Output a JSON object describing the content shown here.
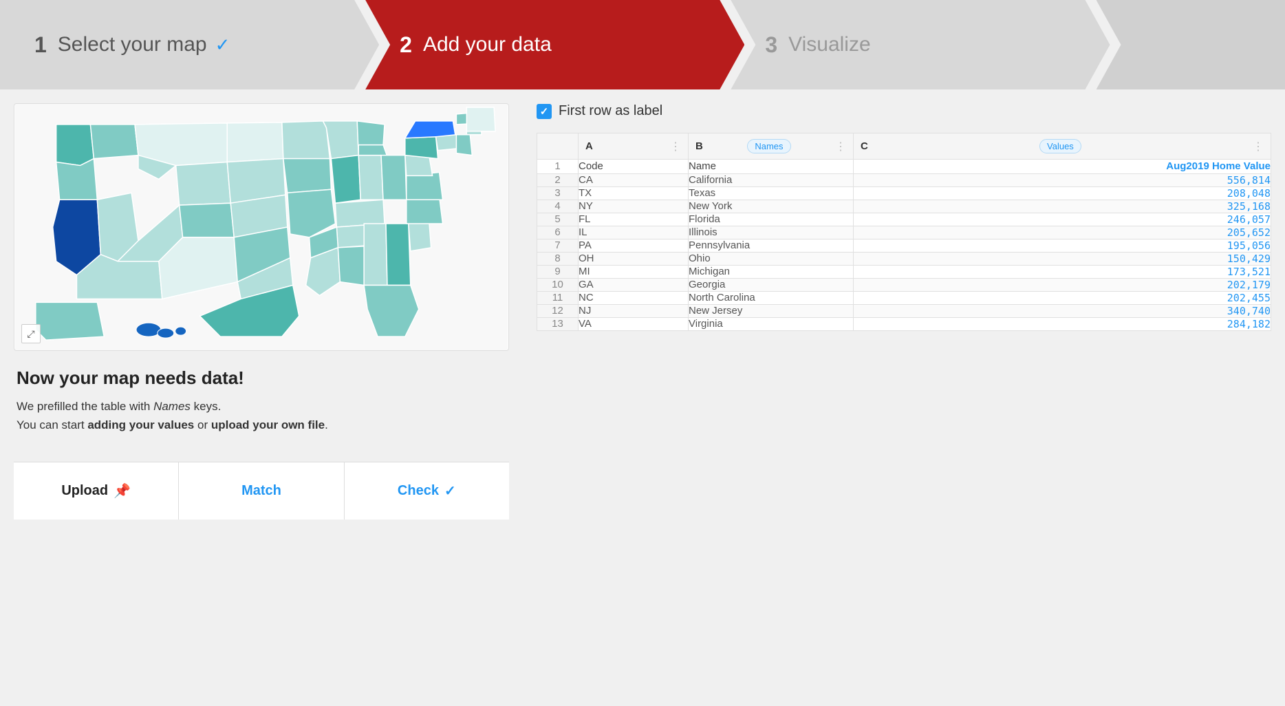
{
  "steps": [
    {
      "id": "step1",
      "number": "1",
      "label": "Select your map",
      "check": "✓",
      "state": "done"
    },
    {
      "id": "step2",
      "number": "2",
      "label": "Add your data",
      "state": "active"
    },
    {
      "id": "step3",
      "number": "3",
      "label": "Visualize",
      "state": "inactive"
    },
    {
      "id": "step4",
      "number": "4",
      "label": "",
      "state": "inactive"
    }
  ],
  "left_panel": {
    "info_heading": "Now your map needs data!",
    "info_line1": "We prefilled the table with ",
    "info_italic": "Names",
    "info_line1_end": " keys.",
    "info_line2_start": "You can start ",
    "info_bold1": "adding your values",
    "info_line2_mid": " or ",
    "info_bold2": "upload your own file",
    "info_line2_end": ".",
    "tabs": [
      {
        "id": "upload",
        "label": "Upload",
        "icon": "📌",
        "active": true
      },
      {
        "id": "match",
        "label": "Match",
        "active": false
      },
      {
        "id": "check",
        "label": "Check",
        "check": "✓",
        "active": false
      }
    ]
  },
  "right_panel": {
    "first_row_label": "First row as label",
    "columns": [
      {
        "letter": "A",
        "tag": null
      },
      {
        "letter": "B",
        "tag": "Names"
      },
      {
        "letter": "C",
        "tag": "Values"
      }
    ],
    "rows": [
      {
        "num": 1,
        "code": "Code",
        "name": "Name",
        "value": "Aug2019 Home Value",
        "is_label": true
      },
      {
        "num": 2,
        "code": "CA",
        "name": "California",
        "value": "556,814"
      },
      {
        "num": 3,
        "code": "TX",
        "name": "Texas",
        "value": "208,048"
      },
      {
        "num": 4,
        "code": "NY",
        "name": "New York",
        "value": "325,168"
      },
      {
        "num": 5,
        "code": "FL",
        "name": "Florida",
        "value": "246,057"
      },
      {
        "num": 6,
        "code": "IL",
        "name": "Illinois",
        "value": "205,652"
      },
      {
        "num": 7,
        "code": "PA",
        "name": "Pennsylvania",
        "value": "195,056"
      },
      {
        "num": 8,
        "code": "OH",
        "name": "Ohio",
        "value": "150,429"
      },
      {
        "num": 9,
        "code": "MI",
        "name": "Michigan",
        "value": "173,521"
      },
      {
        "num": 10,
        "code": "GA",
        "name": "Georgia",
        "value": "202,179"
      },
      {
        "num": 11,
        "code": "NC",
        "name": "North Carolina",
        "value": "202,455"
      },
      {
        "num": 12,
        "code": "NJ",
        "name": "New Jersey",
        "value": "340,740"
      },
      {
        "num": 13,
        "code": "VA",
        "name": "Virginia",
        "value": "284,182"
      }
    ]
  }
}
